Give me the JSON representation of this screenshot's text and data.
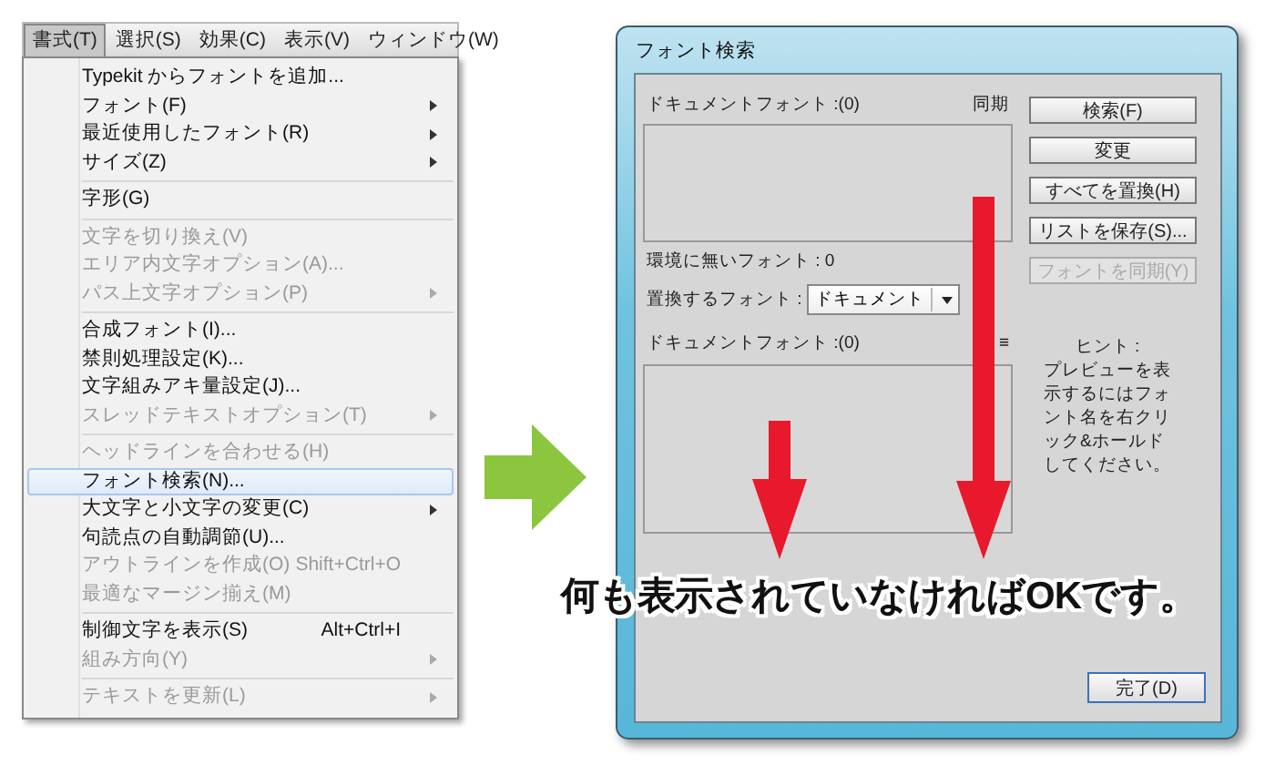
{
  "menubar": [
    {
      "label": "書式(T)",
      "selected": true
    },
    {
      "label": "選択(S)",
      "selected": false
    },
    {
      "label": "効果(C)",
      "selected": false
    },
    {
      "label": "表示(V)",
      "selected": false
    },
    {
      "label": "ウィンドウ(W)",
      "selected": false
    }
  ],
  "menu": {
    "items": [
      {
        "kind": "item",
        "label": "Typekit からフォントを追加...",
        "disabled": false,
        "submenu": false,
        "selected": false
      },
      {
        "kind": "item",
        "label": "フォント(F)",
        "disabled": false,
        "submenu": true,
        "selected": false
      },
      {
        "kind": "item",
        "label": "最近使用したフォント(R)",
        "disabled": false,
        "submenu": true,
        "selected": false
      },
      {
        "kind": "item",
        "label": "サイズ(Z)",
        "disabled": false,
        "submenu": true,
        "selected": false
      },
      {
        "kind": "separator"
      },
      {
        "kind": "item",
        "label": "字形(G)",
        "disabled": false,
        "submenu": false,
        "selected": false
      },
      {
        "kind": "separator"
      },
      {
        "kind": "item",
        "label": "文字を切り換え(V)",
        "disabled": true,
        "submenu": false,
        "selected": false
      },
      {
        "kind": "item",
        "label": "エリア内文字オプション(A)...",
        "disabled": true,
        "submenu": false,
        "selected": false
      },
      {
        "kind": "item",
        "label": "パス上文字オプション(P)",
        "disabled": true,
        "submenu": true,
        "selected": false
      },
      {
        "kind": "separator"
      },
      {
        "kind": "item",
        "label": "合成フォント(I)...",
        "disabled": false,
        "submenu": false,
        "selected": false
      },
      {
        "kind": "item",
        "label": "禁則処理設定(K)...",
        "disabled": false,
        "submenu": false,
        "selected": false
      },
      {
        "kind": "item",
        "label": "文字組みアキ量設定(J)...",
        "disabled": false,
        "submenu": false,
        "selected": false
      },
      {
        "kind": "item",
        "label": "スレッドテキストオプション(T)",
        "disabled": true,
        "submenu": true,
        "selected": false
      },
      {
        "kind": "separator"
      },
      {
        "kind": "item",
        "label": "ヘッドラインを合わせる(H)",
        "disabled": true,
        "submenu": false,
        "selected": false
      },
      {
        "kind": "item",
        "label": "フォント検索(N)...",
        "disabled": false,
        "submenu": false,
        "selected": true
      },
      {
        "kind": "item",
        "label": "大文字と小文字の変更(C)",
        "disabled": false,
        "submenu": true,
        "selected": false
      },
      {
        "kind": "item",
        "label": "句読点の自動調節(U)...",
        "disabled": false,
        "submenu": false,
        "selected": false
      },
      {
        "kind": "item",
        "label": "アウトラインを作成(O)",
        "shortcut": "Shift+Ctrl+O",
        "disabled": true,
        "submenu": false,
        "selected": false
      },
      {
        "kind": "item",
        "label": "最適なマージン揃え(M)",
        "disabled": true,
        "submenu": false,
        "selected": false
      },
      {
        "kind": "separator"
      },
      {
        "kind": "item",
        "label": "制御文字を表示(S)",
        "shortcut": "Alt+Ctrl+I",
        "disabled": false,
        "submenu": false,
        "selected": false
      },
      {
        "kind": "item",
        "label": "組み方向(Y)",
        "disabled": true,
        "submenu": true,
        "selected": false
      },
      {
        "kind": "separator"
      },
      {
        "kind": "item",
        "label": "テキストを更新(L)",
        "disabled": true,
        "submenu": true,
        "selected": false
      }
    ]
  },
  "dialog": {
    "title": "フォント検索",
    "document_fonts_label": "ドキュメントフォント :(0)",
    "sync_label": "同期",
    "missing_fonts_label": "環境に無いフォント : 0",
    "replace_label": "置換するフォント :",
    "replace_dropdown": {
      "value": "ドキュメント"
    },
    "replace_fonts_label": "ドキュメントフォント :(0)",
    "list_menu_icon": "≡",
    "buttons": [
      {
        "label": "検索(F)",
        "disabled": false
      },
      {
        "label": "変更",
        "disabled": false
      },
      {
        "label": "すべてを置換(H)",
        "disabled": false
      },
      {
        "label": "リストを保存(S)...",
        "disabled": false
      },
      {
        "label": "フォントを同期(Y)",
        "disabled": true
      }
    ],
    "hint_title": "ヒント :",
    "hint_text": "プレビューを表示するにはフォント名を右クリック&ホールドしてください。",
    "done_button": "完了(D)"
  },
  "annotation": "何も表示されていなければOKです。"
}
